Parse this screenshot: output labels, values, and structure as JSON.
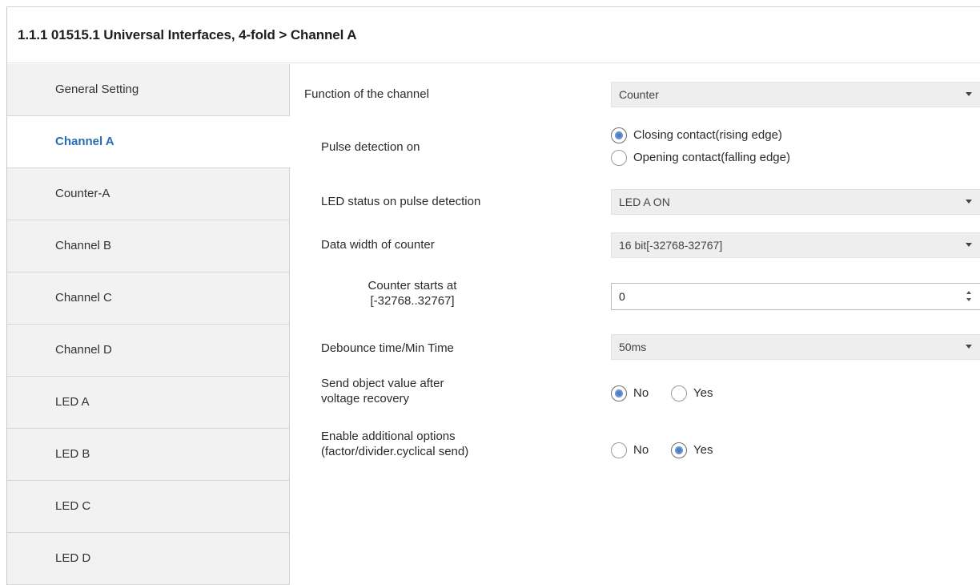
{
  "header": {
    "title": "1.1.1 01515.1 Universal Interfaces, 4-fold > Channel A"
  },
  "sidebar": {
    "items": [
      {
        "label": "General Setting",
        "active": false
      },
      {
        "label": "Channel A",
        "active": true
      },
      {
        "label": "Counter-A",
        "active": false
      },
      {
        "label": "Channel B",
        "active": false
      },
      {
        "label": "Channel C",
        "active": false
      },
      {
        "label": "Channel D",
        "active": false
      },
      {
        "label": "LED A",
        "active": false
      },
      {
        "label": "LED B",
        "active": false
      },
      {
        "label": "LED C",
        "active": false
      },
      {
        "label": "LED D",
        "active": false
      }
    ]
  },
  "params": {
    "function": {
      "label": "Function of the channel",
      "value": "Counter"
    },
    "pulse_detection": {
      "label": "Pulse detection on",
      "options": [
        "Closing contact(rising edge)",
        "Opening contact(falling edge)"
      ],
      "selected": "Closing contact(rising edge)"
    },
    "led_status": {
      "label": "LED status on pulse detection",
      "value": "LED A ON"
    },
    "data_width": {
      "label": "Data width of counter",
      "value": "16 bit[-32768-32767]"
    },
    "counter_start": {
      "label_line1": "Counter starts at",
      "label_line2": "[-32768..32767]",
      "value": "0"
    },
    "debounce": {
      "label": "Debounce time/Min Time",
      "value": "50ms"
    },
    "send_after_recovery": {
      "label_line1": "Send object value after",
      "label_line2": "voltage recovery",
      "options": [
        "No",
        "Yes"
      ],
      "selected": "No"
    },
    "additional_options": {
      "label_line1": "Enable additional options",
      "label_line2": "(factor/divider.cyclical send)",
      "options": [
        "No",
        "Yes"
      ],
      "selected": "Yes"
    }
  },
  "colors": {
    "accent": "#2a6db5",
    "radio_fill": "#4d7fc0",
    "sidebar_bg": "#f2f2f2",
    "dropdown_bg": "#eeeeee"
  }
}
